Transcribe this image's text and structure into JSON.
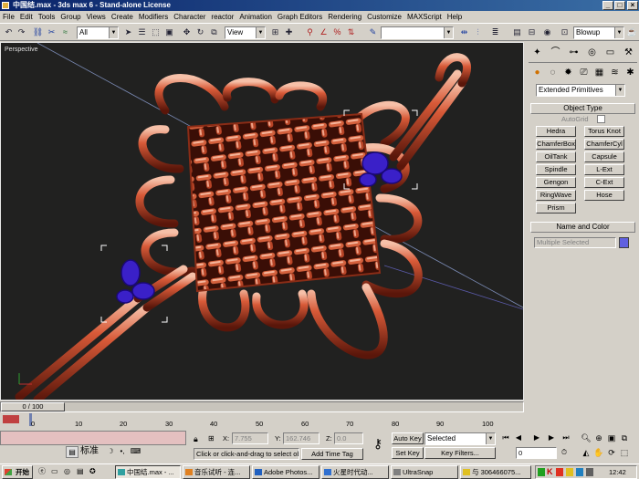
{
  "window": {
    "title": "中国结.max - 3ds max 6 - Stand-alone License"
  },
  "menu": [
    "File",
    "Edit",
    "Tools",
    "Group",
    "Views",
    "Create",
    "Modifiers",
    "Character",
    "reactor",
    "Animation",
    "Graph Editors",
    "Rendering",
    "Customize",
    "MAXScript",
    "Help"
  ],
  "toolbar": {
    "selection_filter": "All",
    "ref_coord": "View",
    "render_type": "Blowup"
  },
  "viewport": {
    "label": "Perspective"
  },
  "command_panel": {
    "category": "Extended Primitives",
    "object_type_title": "Object Type",
    "autogrid_label": "AutoGrid",
    "buttons": [
      "Hedra",
      "Torus Knot",
      "ChamferBox",
      "ChamferCyl",
      "OilTank",
      "Capsule",
      "Spindle",
      "L-Ext",
      "Gengon",
      "C-Ext",
      "RingWave",
      "Hose",
      "Prism"
    ],
    "name_color_title": "Name and Color",
    "name_value": "Multiple Selected",
    "color": "#6060e0"
  },
  "timeline": {
    "frame_label": "0 / 100",
    "ticks": [
      "0",
      "10",
      "20",
      "30",
      "40",
      "50",
      "60",
      "70",
      "80",
      "90",
      "100"
    ]
  },
  "status": {
    "ime_label": "标准",
    "x_label": "X:",
    "x_value": "7.755",
    "y_label": "Y:",
    "y_value": "162.746",
    "z_label": "Z:",
    "z_value": "0.0",
    "prompt": "Click or click-and-drag to select ob",
    "add_time_tag": "Add Time Tag",
    "auto_key": "Auto Key",
    "set_key": "Set Key",
    "key_mode": "Selected",
    "key_filters": "Key Filters...",
    "current_frame": "0"
  },
  "taskbar": {
    "start": "开始",
    "tasks": [
      "中国结.max - ...",
      "音乐试听 - 连...",
      "Adobe Photos...",
      "火星时代动...",
      "UltraSnap",
      "与 306466075..."
    ],
    "clock": "12:42"
  }
}
